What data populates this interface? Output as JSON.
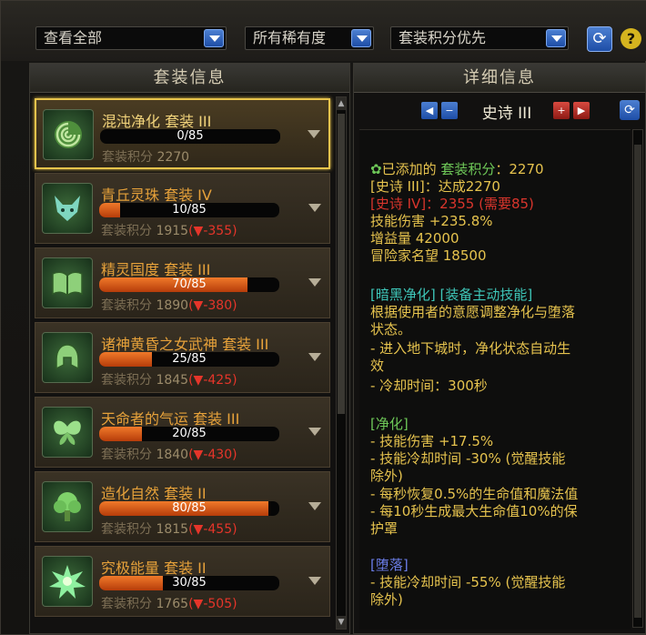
{
  "filters": {
    "view": "查看全部",
    "rarity": "所有稀有度",
    "sort": "套装积分优先"
  },
  "help_label": "?",
  "left_panel": {
    "title": "套装信息"
  },
  "right_panel": {
    "title": "详细信息",
    "grade": "史诗 III"
  },
  "score_label": "套装积分",
  "sets": [
    {
      "name": "混沌净化   套装 III",
      "progress": "0/85",
      "fill": 0.0,
      "score": "2270",
      "delta": "",
      "icon": "rose-icon",
      "selected": true
    },
    {
      "name": "青丘灵珠   套装 IV",
      "progress": "10/85",
      "fill": 0.118,
      "score": "1915",
      "delta": "(▼-355)",
      "icon": "fox-icon"
    },
    {
      "name": "精灵国度   套装 III",
      "progress": "70/85",
      "fill": 0.824,
      "score": "1890",
      "delta": "(▼-380)",
      "icon": "book-icon"
    },
    {
      "name": "诸神黄昏之女武神   套装 III",
      "progress": "25/85",
      "fill": 0.294,
      "score": "1845",
      "delta": "(▼-425)",
      "icon": "helmet-icon"
    },
    {
      "name": "天命者的气运   套装 III",
      "progress": "20/85",
      "fill": 0.235,
      "score": "1840",
      "delta": "(▼-430)",
      "icon": "butterfly-icon"
    },
    {
      "name": "造化自然   套装 II",
      "progress": "80/85",
      "fill": 0.941,
      "score": "1815",
      "delta": "(▼-455)",
      "icon": "tree-icon"
    },
    {
      "name": "究极能量   套装 II",
      "progress": "30/85",
      "fill": 0.353,
      "score": "1765",
      "delta": "(▼-505)",
      "icon": "burst-icon"
    }
  ],
  "detail": {
    "added_prefix": "已添加的 ",
    "added_green": "套装积分",
    "added_suffix": "：2270",
    "epic3": "[史诗 III]：达成2270",
    "epic4": "[史诗 IV]：2355 (需要85)",
    "skill_damage": "技能伤害 +235.8%",
    "gain": "增益量 42000",
    "fame": "冒险家名望 18500",
    "dark_title": "[暗黑净化]",
    "dark_tag": " [装备主动技能]",
    "dark_desc1": "根据使用者的意愿调整净化与堕落",
    "dark_desc2": "状态。",
    "dark_line1": "- 进入地下城时，净化状态自动生",
    "dark_line2": "效",
    "dark_line3": "- 冷却时间：300秒",
    "purify_title": "[净化]",
    "purify1": "- 技能伤害 +17.5%",
    "purify2": "- 技能冷却时间 -30% (觉醒技能",
    "purify3": "除外)",
    "purify4": "- 每秒恢复0.5%的生命值和魔法值",
    "purify5": "- 每10秒生成最大生命值10%的保",
    "purify6": "护罩",
    "fall_title": "[堕落]",
    "fall1": "- 技能冷却时间 -55% (觉醒技能",
    "fall2": "除外)"
  }
}
